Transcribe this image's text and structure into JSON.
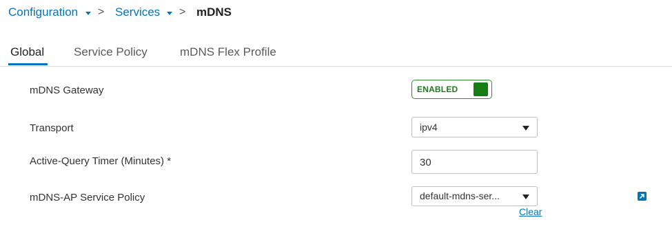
{
  "breadcrumb": {
    "items": [
      {
        "label": "Configuration"
      },
      {
        "label": "Services"
      }
    ],
    "separator": ">",
    "current": "mDNS"
  },
  "tabs": [
    {
      "label": "Global",
      "active": true
    },
    {
      "label": "Service Policy",
      "active": false
    },
    {
      "label": "mDNS Flex Profile",
      "active": false
    }
  ],
  "form": {
    "gateway": {
      "label": "mDNS Gateway",
      "toggle_text": "ENABLED",
      "enabled": true
    },
    "transport": {
      "label": "Transport",
      "value": "ipv4"
    },
    "timer": {
      "label": "Active-Query Timer (Minutes) *",
      "value": "30"
    },
    "policy": {
      "label": "mDNS-AP Service Policy",
      "value": "default-mdns-ser...",
      "clear_label": "Clear"
    }
  },
  "icons": {
    "breadcrumb_dropdown": "caret-down-icon",
    "breadcrumb_separator": "chevron-right-icon",
    "select_arrow": "caret-down-icon",
    "policy_link": "external-link-icon"
  },
  "colors": {
    "accent": "#0175b7",
    "enabled_border": "#2c8c2c",
    "enabled_knob": "#167d16",
    "enabled_text": "#1e7a1e"
  }
}
